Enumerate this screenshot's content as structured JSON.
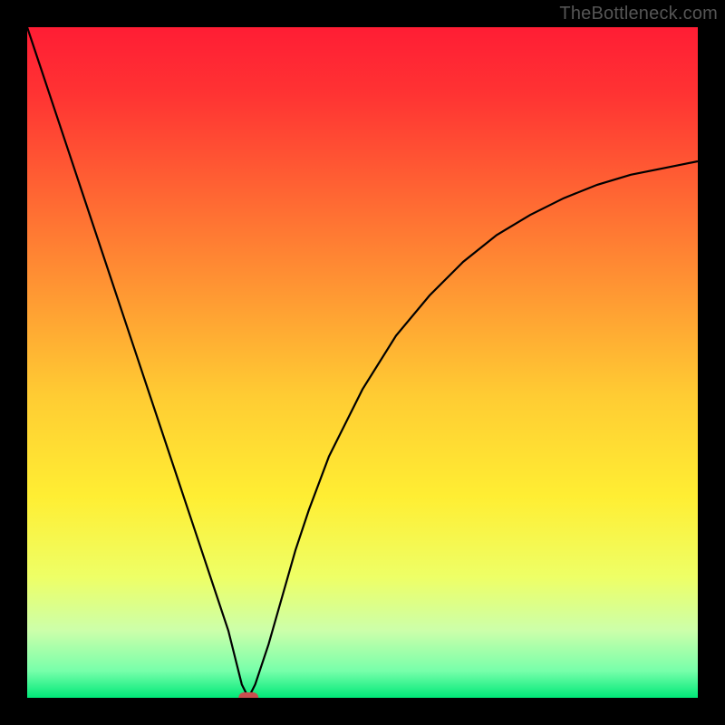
{
  "watermark": "TheBottleneck.com",
  "chart_data": {
    "type": "line",
    "title": "",
    "xlabel": "",
    "ylabel": "",
    "xlim": [
      0,
      100
    ],
    "ylim": [
      0,
      100
    ],
    "x": [
      0,
      2,
      4,
      6,
      8,
      10,
      12,
      14,
      16,
      18,
      20,
      22,
      24,
      26,
      28,
      30,
      31,
      32,
      33,
      34,
      36,
      38,
      40,
      42,
      45,
      50,
      55,
      60,
      65,
      70,
      75,
      80,
      85,
      90,
      95,
      100
    ],
    "y": [
      100,
      94,
      88,
      82,
      76,
      70,
      64,
      58,
      52,
      46,
      40,
      34,
      28,
      22,
      16,
      10,
      6,
      2,
      0,
      2,
      8,
      15,
      22,
      28,
      36,
      46,
      54,
      60,
      65,
      69,
      72,
      74.5,
      76.5,
      78,
      79,
      80
    ],
    "marker": {
      "x": 33,
      "y": 0
    },
    "gradient_stops": [
      {
        "offset": 0.0,
        "color": "#ff1d34"
      },
      {
        "offset": 0.1,
        "color": "#ff3333"
      },
      {
        "offset": 0.25,
        "color": "#ff6633"
      },
      {
        "offset": 0.4,
        "color": "#ff9933"
      },
      {
        "offset": 0.55,
        "color": "#ffcc33"
      },
      {
        "offset": 0.7,
        "color": "#ffee33"
      },
      {
        "offset": 0.82,
        "color": "#eeff66"
      },
      {
        "offset": 0.9,
        "color": "#ccffaa"
      },
      {
        "offset": 0.96,
        "color": "#77ffaa"
      },
      {
        "offset": 1.0,
        "color": "#00e878"
      }
    ],
    "background": "#000000"
  }
}
